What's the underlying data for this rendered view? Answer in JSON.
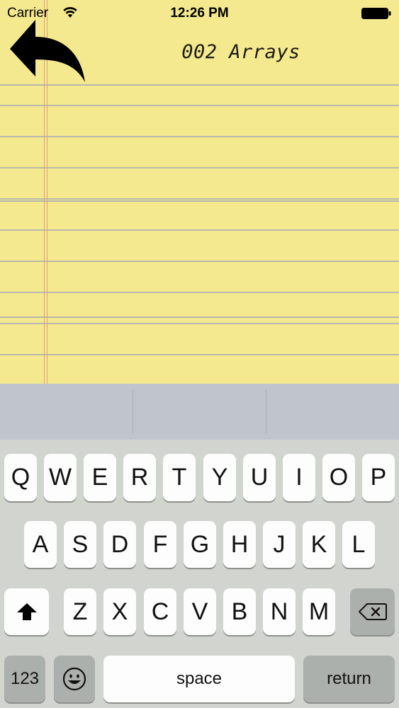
{
  "status_bar": {
    "carrier": "Carrier",
    "time": "12:26 PM"
  },
  "header": {
    "title": "002 Arrays",
    "back_icon": "curved-back-arrow-icon"
  },
  "suggestions": [
    "",
    "",
    ""
  ],
  "keyboard": {
    "row1": [
      "Q",
      "W",
      "E",
      "R",
      "T",
      "Y",
      "U",
      "I",
      "O",
      "P"
    ],
    "row2": [
      "A",
      "S",
      "D",
      "F",
      "G",
      "H",
      "J",
      "K",
      "L"
    ],
    "row3": [
      "Z",
      "X",
      "C",
      "V",
      "B",
      "N",
      "M"
    ],
    "numbers_label": "123",
    "space_label": "space",
    "return_label": "return"
  },
  "colors": {
    "paper": "#f5e98f",
    "rule_line": "#b9b8ae",
    "margin_line": "#e2a07c",
    "keyboard_bg": "#d2d4d0",
    "suggestion_bg": "#c0c5cd"
  }
}
